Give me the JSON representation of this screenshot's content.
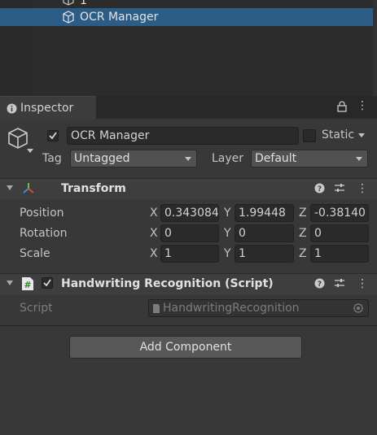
{
  "hierarchy": {
    "items": [
      {
        "label": "1"
      },
      {
        "label": "OCR Manager"
      }
    ]
  },
  "tab": {
    "label": "Inspector"
  },
  "object": {
    "name": "OCR Manager",
    "static_label": "Static",
    "tag_label": "Tag",
    "tag_value": "Untagged",
    "layer_label": "Layer",
    "layer_value": "Default"
  },
  "transform": {
    "title": "Transform",
    "position": {
      "label": "Position",
      "x": "0.343084",
      "y": "1.99448",
      "z": "-0.38140"
    },
    "rotation": {
      "label": "Rotation",
      "x": "0",
      "y": "0",
      "z": "0"
    },
    "scale": {
      "label": "Scale",
      "x": "1",
      "y": "1",
      "z": "1"
    },
    "axes": {
      "x": "X",
      "y": "Y",
      "z": "Z"
    }
  },
  "script_component": {
    "title": "Handwriting Recognition (Script)",
    "script_label": "Script",
    "script_value": "HandwritingRecognition"
  },
  "add_component_label": "Add Component",
  "colors": {
    "selection": "#2c5d87",
    "panel": "#383838",
    "header": "#3e3e3e"
  }
}
